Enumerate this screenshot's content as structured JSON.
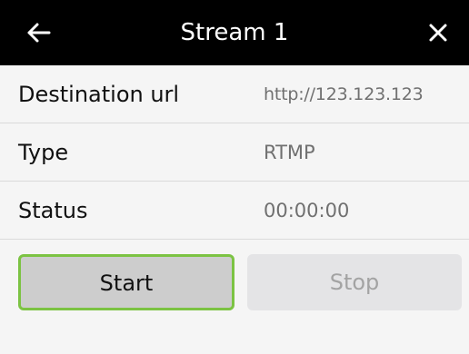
{
  "header": {
    "title": "Stream 1",
    "back_icon": "arrow-left-icon",
    "close_icon": "close-icon"
  },
  "rows": [
    {
      "label": "Destination url",
      "value": "http://123.123.123"
    },
    {
      "label": "Type",
      "value": "RTMP"
    },
    {
      "label": "Status",
      "value": "00:00:00"
    }
  ],
  "buttons": {
    "start_label": "Start",
    "stop_label": "Stop"
  },
  "colors": {
    "header_bg": "#000000",
    "accent_green": "#7cc343",
    "start_bg": "#cdcdcd",
    "stop_bg": "#e4e4e6"
  }
}
